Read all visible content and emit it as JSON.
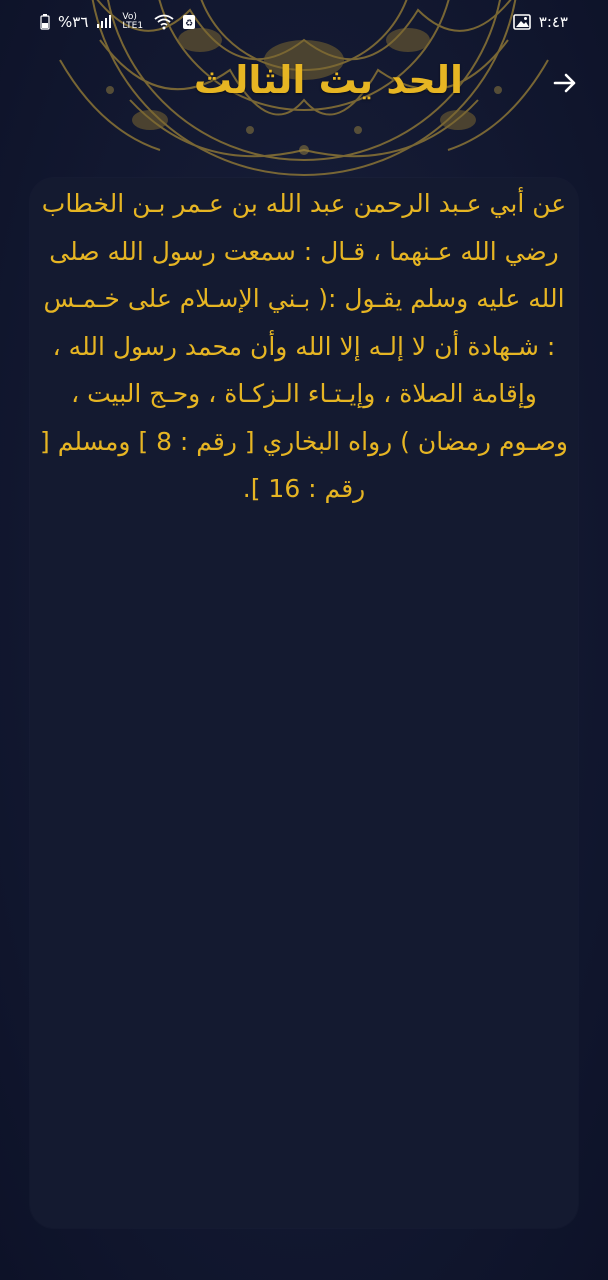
{
  "status_bar": {
    "battery_percent": "%٣٦",
    "network_label": "Vo) LTE1",
    "time": "٣:٤٣"
  },
  "header": {
    "title": "الحد يث الثالث",
    "back_icon": "arrow-right-icon"
  },
  "content": {
    "hadith_text": "عن أبي عـبد الرحمن عبد الله بن عـمر بـن الخطاب رضي الله عـنهما ، قـال : سمعت رسول الله صلى الله عليه وسلم يقـول :( بـني الإسـلام على خـمـس : شـهادة أن لا إلـه إلا الله وأن محمد رسول الله ، وإقامة الصلاة ، وإيـتـاء الـزكـاة ، وحـج البيت ، وصـوم رمضان ) رواه البخاري [ رقم : 8 ] ومسلم [ رقم : 16 ]."
  },
  "colors": {
    "accent_gold": "#e6b523",
    "background": "#141a33",
    "card": "#141a30"
  }
}
